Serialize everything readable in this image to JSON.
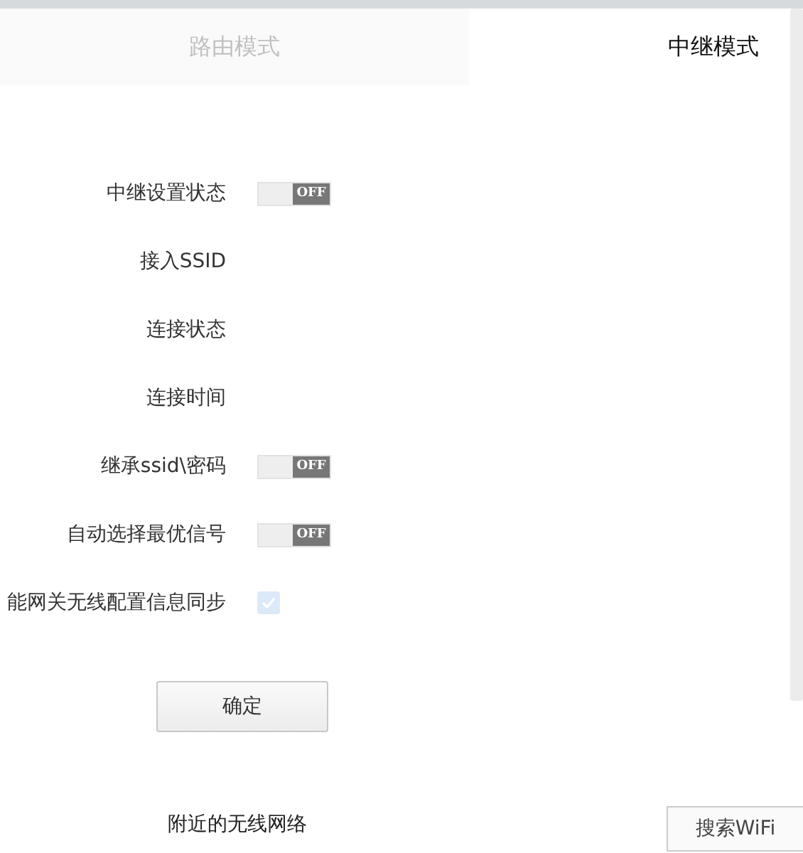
{
  "tabs": [
    {
      "label": "路由模式",
      "selected": false
    },
    {
      "label": "中继模式",
      "selected": true
    }
  ],
  "settings": [
    {
      "label": "中继设置状态",
      "kind": "toggle",
      "on": false,
      "text": "OFF"
    },
    {
      "label": "接入SSID",
      "kind": "text"
    },
    {
      "label": "连接状态",
      "kind": "text"
    },
    {
      "label": "连接时间",
      "kind": "text"
    },
    {
      "label": "继承ssid\\密码",
      "kind": "toggle",
      "on": false,
      "text": "OFF"
    },
    {
      "label": "自动选择最优信号",
      "kind": "toggle",
      "on": false,
      "text": "OFF"
    },
    {
      "label": "能网关无线配置信息同步",
      "kind": "checkbox",
      "checked": true,
      "disabled": true
    }
  ],
  "confirm_button": "确定",
  "nearby_title": "附近的无线网络",
  "search_button": "搜索WiFi"
}
